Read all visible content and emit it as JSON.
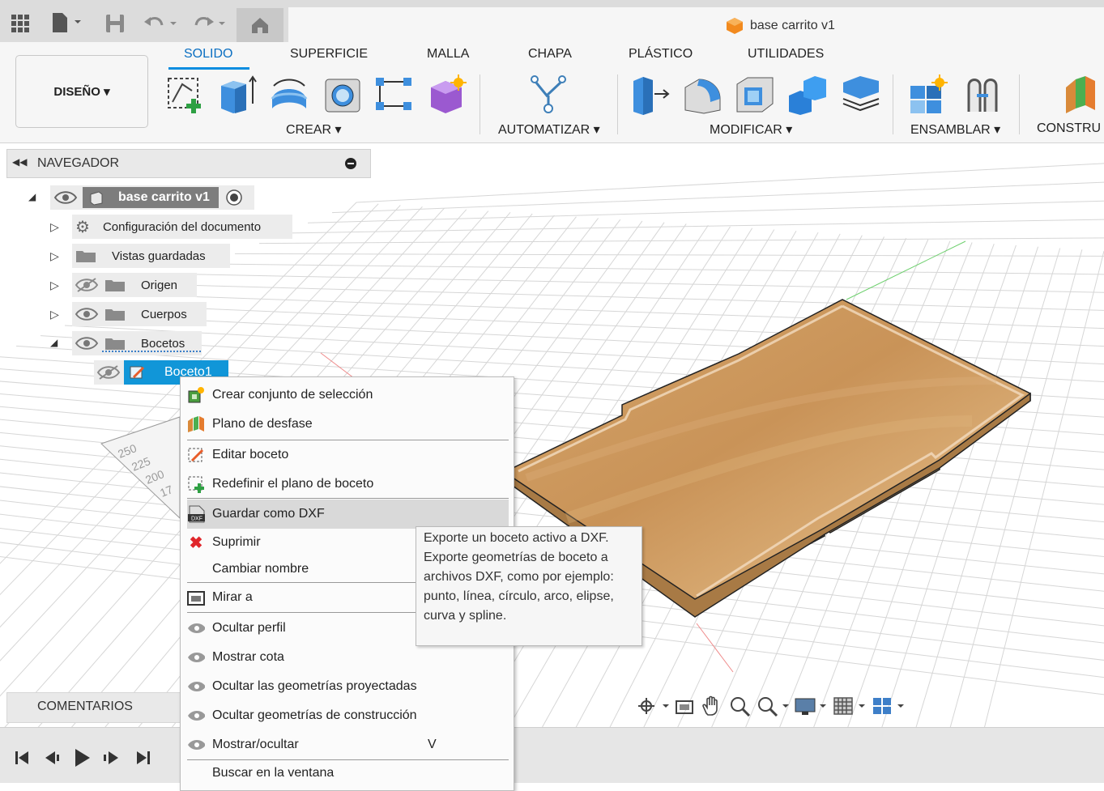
{
  "document": {
    "title": "base carrito v1"
  },
  "ribbon": {
    "workspace_button": "DISEÑO ▾",
    "tabs": [
      "SOLIDO",
      "SUPERFICIE",
      "MALLA",
      "CHAPA",
      "PLÁSTICO",
      "UTILIDADES"
    ],
    "groups": [
      "CREAR ▾",
      "AUTOMATIZAR ▾",
      "MODIFICAR ▾",
      "ENSAMBLAR ▾",
      "CONSTRU"
    ]
  },
  "navigator": {
    "title": "NAVEGADOR",
    "root": "base carrito v1",
    "items": [
      "Configuración del documento",
      "Vistas guardadas",
      "Origen",
      "Cuerpos",
      "Bocetos",
      "Boceto1"
    ]
  },
  "comments": {
    "label": "COMENTARIOS"
  },
  "context_menu": {
    "items": [
      "Crear conjunto de selección",
      "Plano de desfase",
      "Editar boceto",
      "Redefinir el plano de boceto",
      "Guardar como DXF",
      "Suprimir",
      "Cambiar nombre",
      "Mirar a",
      "Ocultar perfil",
      "Mostrar cota",
      "Ocultar las geometrías proyectadas",
      "Ocultar geometrías de construcción",
      "Mostrar/ocultar",
      "Buscar en la ventana"
    ],
    "shortcut_show_hide": "V",
    "dxf_icon_text": "DXF"
  },
  "tooltip": {
    "lines": [
      "Exporte un boceto activo a DXF.",
      "Exporte geometrías de boceto a",
      "archivos DXF, como por ejemplo:",
      "punto, línea, círculo, arco, elipse,",
      "curva y spline."
    ]
  },
  "sketch_dims": [
    "250",
    "225",
    "200",
    "17"
  ],
  "colors": {
    "accent": "#0a8de0",
    "selection": "#1196d8",
    "wood": "#c8955a",
    "delete": "#e0262b"
  }
}
